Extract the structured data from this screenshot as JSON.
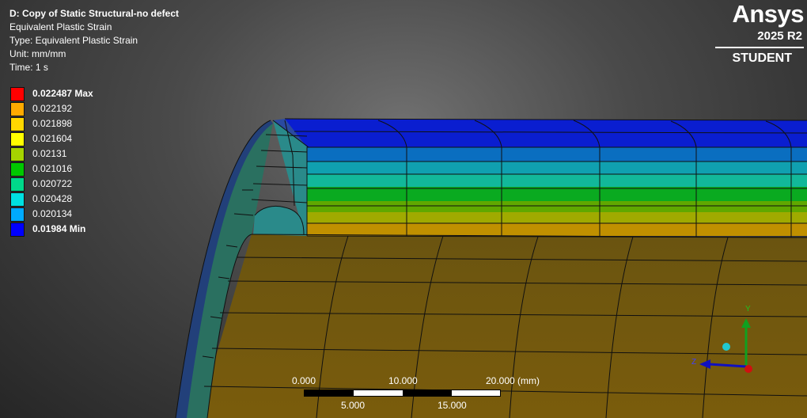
{
  "info": {
    "title": "D: Copy of Static Structural-no defect",
    "result_name": "Equivalent Plastic Strain",
    "type": "Type: Equivalent Plastic Strain",
    "unit": "Unit: mm/mm",
    "time": "Time: 1 s"
  },
  "legend": {
    "entries": [
      {
        "label": "0.022487 Max",
        "color": "#ff0000",
        "bold": true
      },
      {
        "label": "0.022192",
        "color": "#ffaa00",
        "bold": false
      },
      {
        "label": "0.021898",
        "color": "#ffd700",
        "bold": false
      },
      {
        "label": "0.021604",
        "color": "#ffff00",
        "bold": false
      },
      {
        "label": "0.02131",
        "color": "#a5d400",
        "bold": false
      },
      {
        "label": "0.021016",
        "color": "#00c800",
        "bold": false
      },
      {
        "label": "0.020722",
        "color": "#00d98a",
        "bold": false
      },
      {
        "label": "0.020428",
        "color": "#00e0e0",
        "bold": false
      },
      {
        "label": "0.020134",
        "color": "#00aaff",
        "bold": false
      },
      {
        "label": "0.01984 Min",
        "color": "#0000ff",
        "bold": true
      }
    ]
  },
  "logo": {
    "brand": "Ansys",
    "version": "2025 R2",
    "edition": "STUDENT"
  },
  "scale_bar": {
    "top_labels": [
      "0.000",
      "10.000",
      "20.000 (mm)"
    ],
    "bottom_labels": [
      "5.000",
      "15.000"
    ]
  },
  "triad": {
    "y_label": "Y",
    "z_label": "Z"
  }
}
